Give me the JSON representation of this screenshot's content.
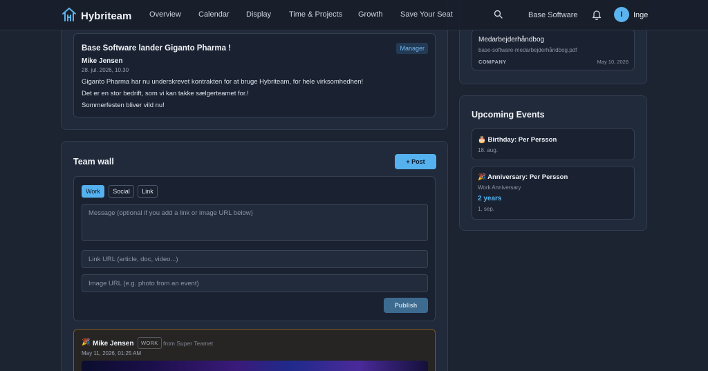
{
  "header": {
    "brand": "Hybriteam",
    "nav": [
      "Overview",
      "Calendar",
      "Display",
      "Time & Projects",
      "Growth",
      "Save Your Seat"
    ],
    "org": "Base Software",
    "avatar_initial": "I",
    "user": "Inge"
  },
  "announcement": {
    "title": "Base Software lander Giganto Pharma !",
    "badge": "Manager",
    "author": "Mike Jensen",
    "date": "28. jul. 2026, 10.30",
    "lines": [
      "Giganto Pharma har nu underskrevet kontrakten for at bruge Hybriteam, for hele virksomhedhen!",
      "Det er en stor bedrift, som vi kan takke sælgerteamet for.!",
      "Sommerfesten bliver vild nu!"
    ]
  },
  "team_wall": {
    "title": "Team wall",
    "post_button": "+ Post",
    "chips": [
      "Work",
      "Social",
      "Link"
    ],
    "message_placeholder": "Message (optional if you add a link or image URL below)",
    "link_placeholder": "Link URL (article, doc, video...)",
    "image_placeholder": "Image URL (e.g. photo from an event)",
    "publish": "Publish",
    "post": {
      "emoji": "🎉",
      "author": "Mike Jensen",
      "tag": "WORK",
      "from": "from Super Teamet",
      "date": "May 11, 2026, 01:25 AM"
    }
  },
  "documents": {
    "doc_title": "Medarbejderhåndbog",
    "doc_file": "base-software-medarbejderhåndbog.pdf",
    "doc_category": "COMPANY",
    "doc_date": "May 10, 2026"
  },
  "events": {
    "title": "Upcoming Events",
    "items": [
      {
        "title": "🎂 Birthday: Per Persson",
        "date": "18. aug."
      },
      {
        "title": "🎉 Anniversary: Per Persson",
        "subtitle": "Work Anniversary",
        "years": "2 years",
        "date": "1. sep."
      }
    ]
  },
  "colors": {
    "accent": "#55b2ef",
    "background": "#1c2331",
    "card": "#212a3a"
  }
}
